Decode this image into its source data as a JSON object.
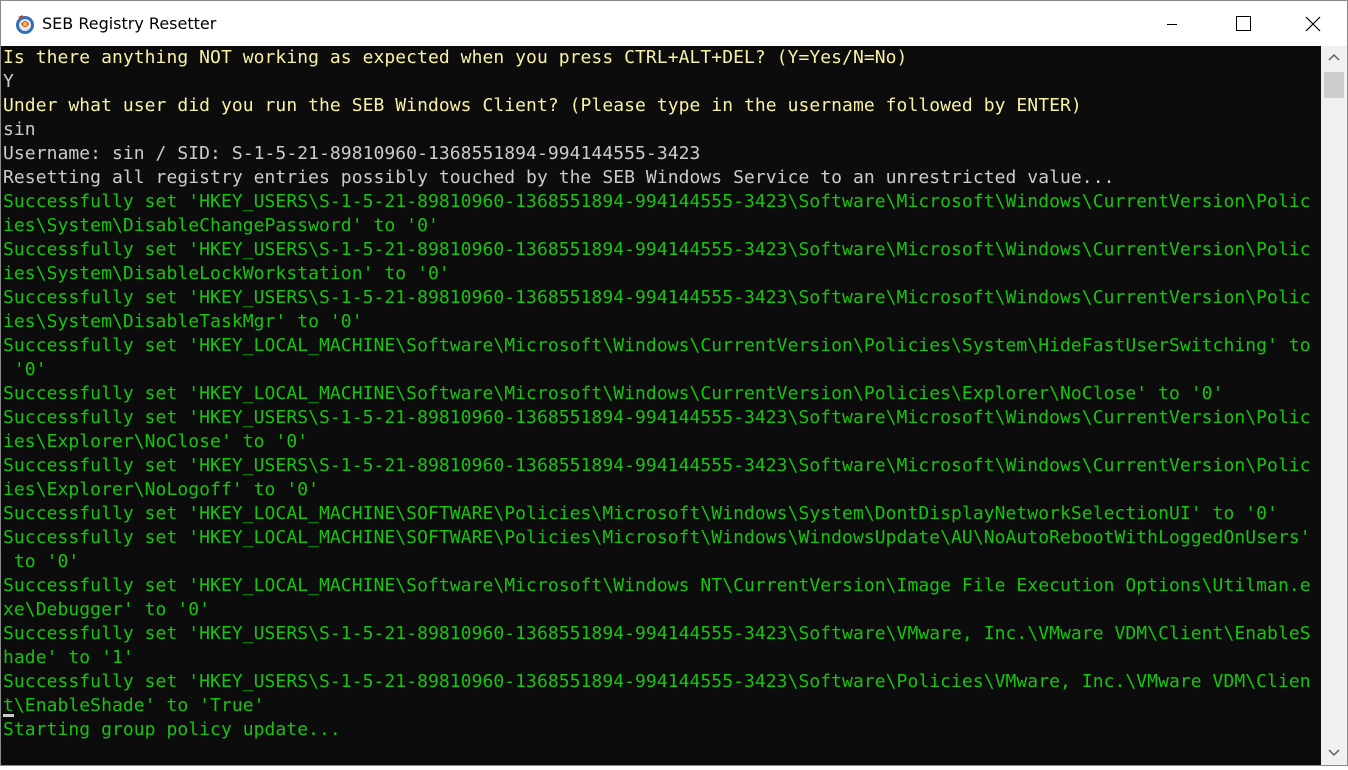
{
  "window": {
    "title": "SEB Registry Resetter",
    "app_icon": "seb-app-icon",
    "controls": [
      "minimize-icon",
      "maximize-icon",
      "close-icon"
    ]
  },
  "colors": {
    "prompt_yellow": "#f9f1a5",
    "text_gray": "#cccccc",
    "success_green": "#16c60c",
    "console_background": "#0c0c0c"
  },
  "console": {
    "lines": [
      {
        "text": "Is there anything NOT working as expected when you press CTRL+ALT+DEL? (Y=Yes/N=No)",
        "color": "yellow"
      },
      {
        "text": "Y",
        "color": "gray"
      },
      {
        "text": "Under what user did you run the SEB Windows Client? (Please type in the username followed by ENTER)",
        "color": "yellow"
      },
      {
        "text": "sin",
        "color": "gray"
      },
      {
        "text": "Username: sin / SID: S-1-5-21-89810960-1368551894-994144555-3423",
        "color": "gray"
      },
      {
        "text": "Resetting all registry entries possibly touched by the SEB Windows Service to an unrestricted value...",
        "color": "gray"
      },
      {
        "text": "Successfully set 'HKEY_USERS\\S-1-5-21-89810960-1368551894-994144555-3423\\Software\\Microsoft\\Windows\\CurrentVersion\\Polic",
        "color": "green"
      },
      {
        "text": "ies\\System\\DisableChangePassword' to '0'",
        "color": "green"
      },
      {
        "text": "Successfully set 'HKEY_USERS\\S-1-5-21-89810960-1368551894-994144555-3423\\Software\\Microsoft\\Windows\\CurrentVersion\\Polic",
        "color": "green"
      },
      {
        "text": "ies\\System\\DisableLockWorkstation' to '0'",
        "color": "green"
      },
      {
        "text": "Successfully set 'HKEY_USERS\\S-1-5-21-89810960-1368551894-994144555-3423\\Software\\Microsoft\\Windows\\CurrentVersion\\Polic",
        "color": "green"
      },
      {
        "text": "ies\\System\\DisableTaskMgr' to '0'",
        "color": "green"
      },
      {
        "text": "Successfully set 'HKEY_LOCAL_MACHINE\\Software\\Microsoft\\Windows\\CurrentVersion\\Policies\\System\\HideFastUserSwitching' to",
        "color": "green"
      },
      {
        "text": " '0'",
        "color": "green"
      },
      {
        "text": "Successfully set 'HKEY_LOCAL_MACHINE\\Software\\Microsoft\\Windows\\CurrentVersion\\Policies\\Explorer\\NoClose' to '0'",
        "color": "green"
      },
      {
        "text": "Successfully set 'HKEY_USERS\\S-1-5-21-89810960-1368551894-994144555-3423\\Software\\Microsoft\\Windows\\CurrentVersion\\Polic",
        "color": "green"
      },
      {
        "text": "ies\\Explorer\\NoClose' to '0'",
        "color": "green"
      },
      {
        "text": "Successfully set 'HKEY_USERS\\S-1-5-21-89810960-1368551894-994144555-3423\\Software\\Microsoft\\Windows\\CurrentVersion\\Polic",
        "color": "green"
      },
      {
        "text": "ies\\Explorer\\NoLogoff' to '0'",
        "color": "green"
      },
      {
        "text": "Successfully set 'HKEY_LOCAL_MACHINE\\SOFTWARE\\Policies\\Microsoft\\Windows\\System\\DontDisplayNetworkSelectionUI' to '0'",
        "color": "green"
      },
      {
        "text": "Successfully set 'HKEY_LOCAL_MACHINE\\SOFTWARE\\Policies\\Microsoft\\Windows\\WindowsUpdate\\AU\\NoAutoRebootWithLoggedOnUsers'",
        "color": "green"
      },
      {
        "text": " to '0'",
        "color": "green"
      },
      {
        "text": "Successfully set 'HKEY_LOCAL_MACHINE\\Software\\Microsoft\\Windows NT\\CurrentVersion\\Image File Execution Options\\Utilman.e",
        "color": "green"
      },
      {
        "text": "xe\\Debugger' to '0'",
        "color": "green"
      },
      {
        "text": "Successfully set 'HKEY_USERS\\S-1-5-21-89810960-1368551894-994144555-3423\\Software\\VMware, Inc.\\VMware VDM\\Client\\EnableS",
        "color": "green"
      },
      {
        "text": "hade' to '1'",
        "color": "green"
      },
      {
        "text": "Successfully set 'HKEY_USERS\\S-1-5-21-89810960-1368551894-994144555-3423\\Software\\Policies\\VMware, Inc.\\VMware VDM\\Clien",
        "color": "green"
      },
      {
        "text": "t\\EnableShade' to 'True'",
        "color": "green"
      },
      {
        "text": "Starting group policy update...",
        "color": "green"
      }
    ]
  },
  "scrollbar": {
    "up_icon": "scroll-up-arrow-icon",
    "down_icon": "scroll-down-arrow-icon"
  }
}
